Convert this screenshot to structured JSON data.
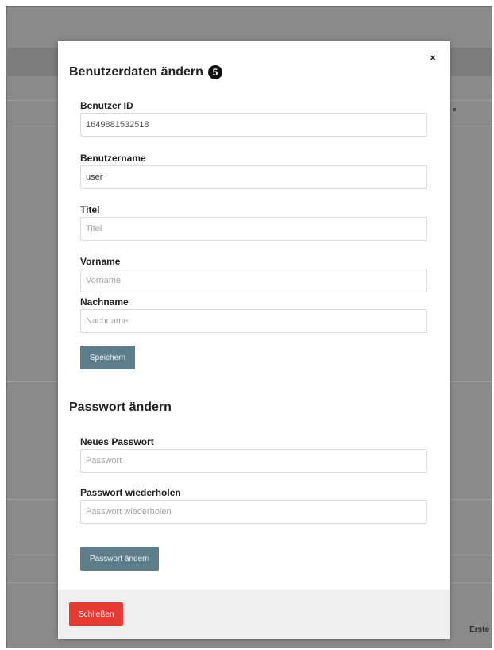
{
  "background": {
    "right_text": "Erste"
  },
  "modal": {
    "close_glyph": "×",
    "title": "Benutzerdaten ändern",
    "step_number": "5",
    "user_section": {
      "fields": [
        {
          "label": "Benutzer ID",
          "value": "1649881532518",
          "placeholder": ""
        },
        {
          "label": "Benutzername",
          "value": "user",
          "placeholder": ""
        },
        {
          "label": "Titel",
          "value": "",
          "placeholder": "Titel"
        },
        {
          "label": "Vorname",
          "value": "",
          "placeholder": "Vorname"
        },
        {
          "label": "Nachname",
          "value": "",
          "placeholder": "Nachname"
        }
      ],
      "save_label": "Speichern"
    },
    "password_section": {
      "title": "Passwort ändern",
      "fields": [
        {
          "label": "Neues Passwort",
          "value": "",
          "placeholder": "Passwort"
        },
        {
          "label": "Passwort wiederholen",
          "value": "",
          "placeholder": "Passwort wiederholen"
        }
      ],
      "submit_label": "Passwort ändern"
    },
    "footer": {
      "close_label": "Schließen"
    }
  },
  "colors": {
    "primary_button": "#5d7d8b",
    "danger_button": "#e63b33",
    "backdrop": "#8a8a8a"
  }
}
